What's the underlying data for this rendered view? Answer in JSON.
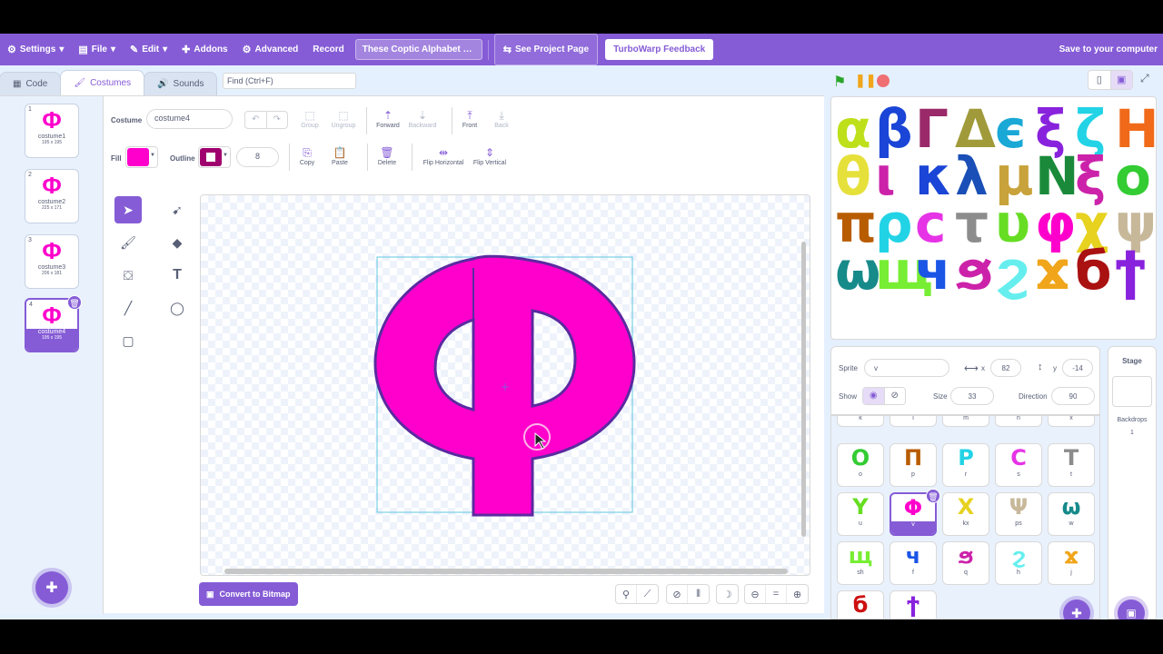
{
  "menubar": {
    "settings": "Settings",
    "file": "File",
    "edit": "Edit",
    "addons": "Addons",
    "advanced": "Advanced",
    "record": "Record",
    "project_title": "These Coptic Alphabet ar...",
    "see_project": "See Project Page",
    "feedback": "TurboWarp Feedback",
    "save": "Save to your computer"
  },
  "tabs": {
    "code": "Code",
    "costumes": "Costumes",
    "sounds": "Sounds"
  },
  "find": "Find (Ctrl+F)",
  "costumes": [
    {
      "num": "1",
      "glyph": "Φ",
      "name": "costume1",
      "size": "195 x 195"
    },
    {
      "num": "2",
      "glyph": "Φ",
      "name": "costume2",
      "size": "225 x 171"
    },
    {
      "num": "3",
      "glyph": "Φ",
      "name": "costume3",
      "size": "206 x 181"
    },
    {
      "num": "4",
      "glyph": "Φ",
      "name": "costume4",
      "size": "195 x 195"
    }
  ],
  "toolbar": {
    "costume_label": "Costume",
    "costume_name": "costume4",
    "group": "Group",
    "ungroup": "Ungroup",
    "forward": "Forward",
    "backward": "Backward",
    "front": "Front",
    "back": "Back",
    "fill_label": "Fill",
    "outline_label": "Outline",
    "outline_width": "8",
    "copy": "Copy",
    "paste": "Paste",
    "delete": "Delete",
    "flip_h": "Flip Horizontal",
    "flip_v": "Flip Vertical",
    "fill_color": "#ff00cc",
    "outline_color": "#a0006e"
  },
  "convert_bitmap": "Convert to Bitmap",
  "sprite_info": {
    "sprite_label": "Sprite",
    "sprite_name": "v",
    "x_label": "x",
    "x": "82",
    "y_label": "y",
    "y": "-14",
    "show_label": "Show",
    "size_label": "Size",
    "size": "33",
    "direction_label": "Direction",
    "direction": "90"
  },
  "sprites": [
    {
      "glyph": "Ο",
      "name": "o",
      "color": "#33cc33"
    },
    {
      "glyph": "Π",
      "name": "p",
      "color": "#b85c00"
    },
    {
      "glyph": "Ρ",
      "name": "r",
      "color": "#22d3e6"
    },
    {
      "glyph": "С",
      "name": "s",
      "color": "#e633e6"
    },
    {
      "glyph": "Т",
      "name": "t",
      "color": "#8c8c8c"
    },
    {
      "glyph": "Υ",
      "name": "u",
      "color": "#66dd22"
    },
    {
      "glyph": "Φ",
      "name": "v",
      "color": "#ff00cc"
    },
    {
      "glyph": "Χ",
      "name": "kx",
      "color": "#e6d21f"
    },
    {
      "glyph": "Ψ",
      "name": "ps",
      "color": "#c8b89a"
    },
    {
      "glyph": "ω",
      "name": "w",
      "color": "#178a8a"
    },
    {
      "glyph": "щ",
      "name": "sh",
      "color": "#77ee33"
    },
    {
      "glyph": "ч",
      "name": "f",
      "color": "#1a55e6"
    },
    {
      "glyph": "ϧ",
      "name": "q",
      "color": "#cc22aa"
    },
    {
      "glyph": "ϩ",
      "name": "h",
      "color": "#66eeee"
    },
    {
      "glyph": "ϫ",
      "name": "j",
      "color": "#f0a51a"
    },
    {
      "glyph": "б",
      "name": "",
      "color": "#cc1111"
    },
    {
      "glyph": "ϯ",
      "name": "",
      "color": "#8822dd"
    }
  ],
  "sprite_top_row": [
    "k",
    "l",
    "m",
    "n",
    "x"
  ],
  "stage_panel": {
    "title": "Stage",
    "backdrops_label": "Backdrops",
    "backdrops_count": "1"
  },
  "stage_glyphs": [
    {
      "ch": "α",
      "color": "#bde01a"
    },
    {
      "ch": "β",
      "color": "#1a45d6"
    },
    {
      "ch": "Γ",
      "color": "#9a2a6a"
    },
    {
      "ch": "Δ",
      "color": "#a09a3a"
    },
    {
      "ch": "є",
      "color": "#1aa8d6"
    },
    {
      "ch": "ξ",
      "color": "#8822dd"
    },
    {
      "ch": "ζ",
      "color": "#22d3e6"
    },
    {
      "ch": "Η",
      "color": "#f06a1a"
    },
    {
      "ch": "θ",
      "color": "#e6e03a"
    },
    {
      "ch": "ι",
      "color": "#cc22aa"
    },
    {
      "ch": "κ",
      "color": "#1a45d6"
    },
    {
      "ch": "λ",
      "color": "#1a4fb8"
    },
    {
      "ch": "μ",
      "color": "#c8a23a"
    },
    {
      "ch": "Ν",
      "color": "#1a8a3a"
    },
    {
      "ch": "ξ",
      "color": "#cc22aa"
    },
    {
      "ch": "ο",
      "color": "#33cc33"
    },
    {
      "ch": "π",
      "color": "#b85c00"
    },
    {
      "ch": "ρ",
      "color": "#22d3e6"
    },
    {
      "ch": "с",
      "color": "#e633e6"
    },
    {
      "ch": "τ",
      "color": "#8c8c8c"
    },
    {
      "ch": "υ",
      "color": "#66dd22"
    },
    {
      "ch": "φ",
      "color": "#ff00cc"
    },
    {
      "ch": "χ",
      "color": "#e6d21f"
    },
    {
      "ch": "ψ",
      "color": "#c8b89a"
    },
    {
      "ch": "ω",
      "color": "#178a8a"
    },
    {
      "ch": "щ",
      "color": "#77ee33"
    },
    {
      "ch": "ч",
      "color": "#1a55e6"
    },
    {
      "ch": "ϧ",
      "color": "#cc22aa"
    },
    {
      "ch": "ϩ",
      "color": "#66eeee"
    },
    {
      "ch": "ϫ",
      "color": "#f0a51a"
    },
    {
      "ch": "б",
      "color": "#aa1111"
    },
    {
      "ch": "ϯ",
      "color": "#8822dd"
    }
  ]
}
